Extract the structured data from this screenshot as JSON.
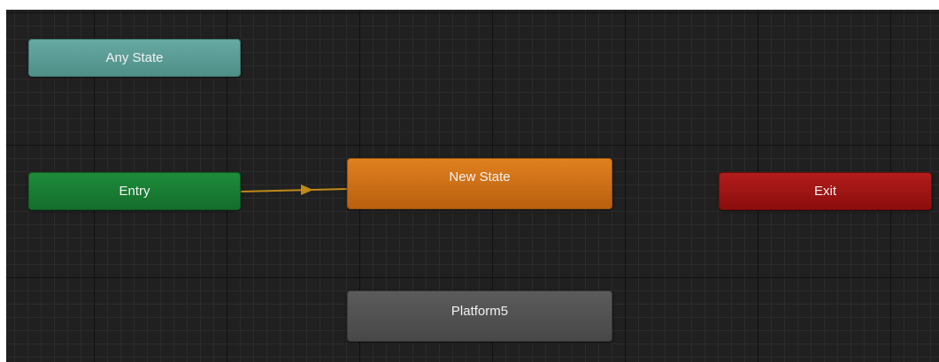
{
  "graph": {
    "nodes": {
      "any_state": {
        "label": "Any State",
        "color": "#5e9f98"
      },
      "entry": {
        "label": "Entry",
        "color": "#1a7f35"
      },
      "new_state": {
        "label": "New State",
        "color": "#d67418",
        "default": true
      },
      "platform5": {
        "label": "Platform5",
        "color": "#525252"
      },
      "exit": {
        "label": "Exit",
        "color": "#a11616"
      }
    },
    "transitions": [
      {
        "from": "Entry",
        "to": "New State",
        "color": "#c08a1a"
      }
    ]
  }
}
